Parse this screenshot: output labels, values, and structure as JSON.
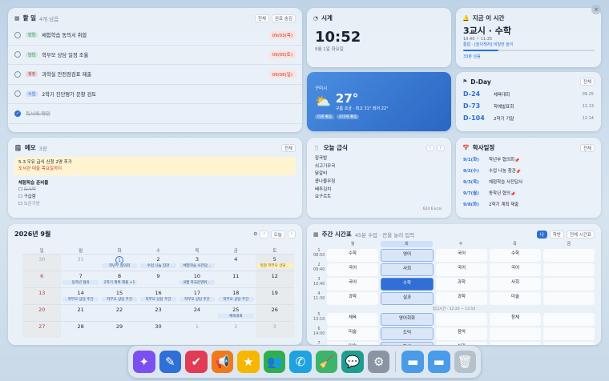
{
  "todo": {
    "title": "할 일",
    "count": "4개 남음",
    "btn_all": "전체",
    "btn_hide": "완료 숨김",
    "items": [
      {
        "tag": "담임",
        "text": "체험학습 동의서 취합",
        "date": "09/03(목)",
        "tag_color": "#2f9a4a"
      },
      {
        "tag": "담임",
        "text": "학부모 상담 일정 조율",
        "date": "09/05(토)",
        "tag_color": "#2f9a4a"
      },
      {
        "tag": "행정",
        "text": "과학실 안전점검표 제출",
        "date": "09/06(일)",
        "tag_color": "#c0392b"
      },
      {
        "tag": "수업",
        "text": "2학기 진단평가 문항 검토",
        "date": "",
        "tag_color": "#2f6fd6"
      },
      {
        "tag": "",
        "text": "독서록 확인",
        "date": "",
        "tag_color": ""
      }
    ]
  },
  "clock": {
    "title": "시계",
    "time": "10:52",
    "date": "9월 1일 화요일"
  },
  "weather": {
    "location": "구미시",
    "temp": "27°",
    "desc": "구름 조금 · 최고 31° 최저 22°",
    "badge1": "미세 좋음",
    "badge2": "초미세 좋음"
  },
  "current_period": {
    "title": "지금 이 시간",
    "period": "3교시 · 수학",
    "time": "10:40 ~ 11:25",
    "detail": "통합 · [놀이책자] 비밀번 놀이",
    "remaining": "33분 남음",
    "progress": 0.27
  },
  "dday": {
    "title": "D-Day",
    "btn": "전체",
    "items": [
      {
        "d": "D-24",
        "name": "체육대회",
        "date": "09.25"
      },
      {
        "d": "D-73",
        "name": "학예발표회",
        "date": "11.13"
      },
      {
        "d": "D-104",
        "name": "2학기 기말",
        "date": "12.14"
      }
    ]
  },
  "memo": {
    "title": "메모",
    "count": "3장",
    "btn": "전체",
    "note1_line1": "5-3 우유 급식 신청 2명 추가",
    "note1_line2": "도서관 대출 목요일까지",
    "note2_title": "체험학습 준비물",
    "note2_items": [
      "도시락",
      "구급함",
      "보온가방"
    ]
  },
  "lunch": {
    "title": "오늘 급식",
    "items": [
      "잡곡밥",
      "쇠고기무국",
      "닭갈비",
      "콩나물무침",
      "배추김치",
      "요구르트"
    ],
    "kcal": "624.6 kcal"
  },
  "academic": {
    "title": "학사일정",
    "btn": "전체",
    "items": [
      {
        "date": "9/1(화)",
        "name": "학년부 협의회",
        "pin": true
      },
      {
        "date": "9/2(수)",
        "name": "수업 나눔 참관",
        "pin": true
      },
      {
        "date": "9/3(목)",
        "name": "체험학습 사전답사",
        "pin": false
      },
      {
        "date": "9/7(월)",
        "name": "동학년 협의",
        "pin": true
      },
      {
        "date": "9/8(화)",
        "name": "2학기 계획 제출",
        "pin": false
      }
    ]
  },
  "calendar": {
    "title": "2026년 9월",
    "today_btn": "오늘",
    "weekdays": [
      "일",
      "월",
      "화",
      "수",
      "목",
      "금",
      "토"
    ],
    "weeks": [
      [
        {
          "d": "30",
          "m": true
        },
        {
          "d": "31",
          "m": true
        },
        {
          "d": "1",
          "today": true,
          "ev": "학년부 협의회"
        },
        {
          "d": "2",
          "ev": "수업 나눔 참관"
        },
        {
          "d": "3",
          "ev": "체험학습 사전답..."
        },
        {
          "d": "4"
        },
        {
          "d": "5",
          "ev": "일정 학부모 상담...",
          "y": true
        }
      ],
      [
        {
          "d": "6"
        },
        {
          "d": "7",
          "ev": "동학년 협의"
        },
        {
          "d": "8",
          "ev": "2학기 계획 제출 +1"
        },
        {
          "d": "9"
        },
        {
          "d": "10",
          "ev": "8월 학교운영위..."
        },
        {
          "d": "11"
        },
        {
          "d": "12"
        }
      ],
      [
        {
          "d": "13"
        },
        {
          "d": "14",
          "ev": "학부모 상담 주간"
        },
        {
          "d": "15",
          "ev": "학부모 상담 주간"
        },
        {
          "d": "16",
          "ev": "학부모 상담 주간"
        },
        {
          "d": "17",
          "ev": "학부모 상담 주간"
        },
        {
          "d": "18",
          "ev": "학부모 상담 주간"
        },
        {
          "d": "19"
        }
      ],
      [
        {
          "d": "20"
        },
        {
          "d": "21"
        },
        {
          "d": "22"
        },
        {
          "d": "23"
        },
        {
          "d": "24"
        },
        {
          "d": "25",
          "ev": "체육대회"
        },
        {
          "d": "26"
        }
      ],
      [
        {
          "d": "27"
        },
        {
          "d": "28"
        },
        {
          "d": "29"
        },
        {
          "d": "30"
        },
        {
          "d": "1",
          "m": true
        },
        {
          "d": "2",
          "m": true
        },
        {
          "d": "3",
          "m": true
        }
      ]
    ]
  },
  "timetable": {
    "title": "주간 시간표",
    "subtitle": "45분 수업 · 칸을 눌러 입력",
    "btn1": "나",
    "btn2": "학반",
    "btn3": "전체 시간표",
    "days": [
      "월",
      "화",
      "수",
      "목",
      "금"
    ],
    "rows": [
      {
        "p": "1",
        "t": "08:50",
        "cells": [
          "수학",
          "영어",
          "국어",
          "수학",
          ""
        ]
      },
      {
        "p": "2",
        "t": "09:40",
        "cells": [
          "국어",
          "사회",
          "국어",
          "국어",
          ""
        ]
      },
      {
        "p": "3",
        "t": "10:40",
        "cells": [
          "국어",
          "수학",
          "과학",
          "사회",
          ""
        ]
      },
      {
        "p": "4",
        "t": "11:30",
        "cells": [
          "과학",
          "실과",
          "과학",
          "미술",
          ""
        ]
      },
      {
        "p": "5",
        "t": "13:10",
        "cells": [
          "체육",
          "영어회화",
          "",
          "창체",
          ""
        ]
      },
      {
        "p": "6",
        "t": "14:00",
        "cells": [
          "미술",
          "도덕",
          "음악",
          "",
          ""
        ]
      },
      {
        "p": "7",
        "t": "",
        "cells": [
          "미술",
          "창체",
          "실과",
          "",
          ""
        ]
      }
    ],
    "lunch_label": "점심시간 · 12:20 ~ 13:10"
  },
  "dock": {
    "apps": [
      {
        "name": "sparkle-icon",
        "glyph": "✦",
        "color": "#7b4ff0"
      },
      {
        "name": "pen-icon",
        "glyph": "✎",
        "color": "#2f6fd6"
      },
      {
        "name": "clipboard-check-icon",
        "glyph": "✔",
        "color": "#e23b55"
      },
      {
        "name": "megaphone-icon",
        "glyph": "📢",
        "color": "#f07a1a"
      },
      {
        "name": "star-icon",
        "glyph": "★",
        "color": "#f5b700"
      },
      {
        "name": "users-icon",
        "glyph": "👥",
        "color": "#2fae4e"
      },
      {
        "name": "phone-icon",
        "glyph": "✆",
        "color": "#1fa3e0"
      },
      {
        "name": "broom-icon",
        "glyph": "🧹",
        "color": "#3db36b"
      },
      {
        "name": "chat-icon",
        "glyph": "💬",
        "color": "#1f9e8f"
      },
      {
        "name": "settings-icon",
        "glyph": "⚙",
        "color": "#8a94a2"
      }
    ],
    "folders": [
      {
        "name": "folder-icon",
        "glyph": "▬",
        "color": "#4a9be8"
      },
      {
        "name": "folder-icon",
        "glyph": "▬",
        "color": "#4a9be8"
      },
      {
        "name": "trash-icon",
        "glyph": "🗑",
        "color": "#b7c1cc"
      }
    ]
  }
}
